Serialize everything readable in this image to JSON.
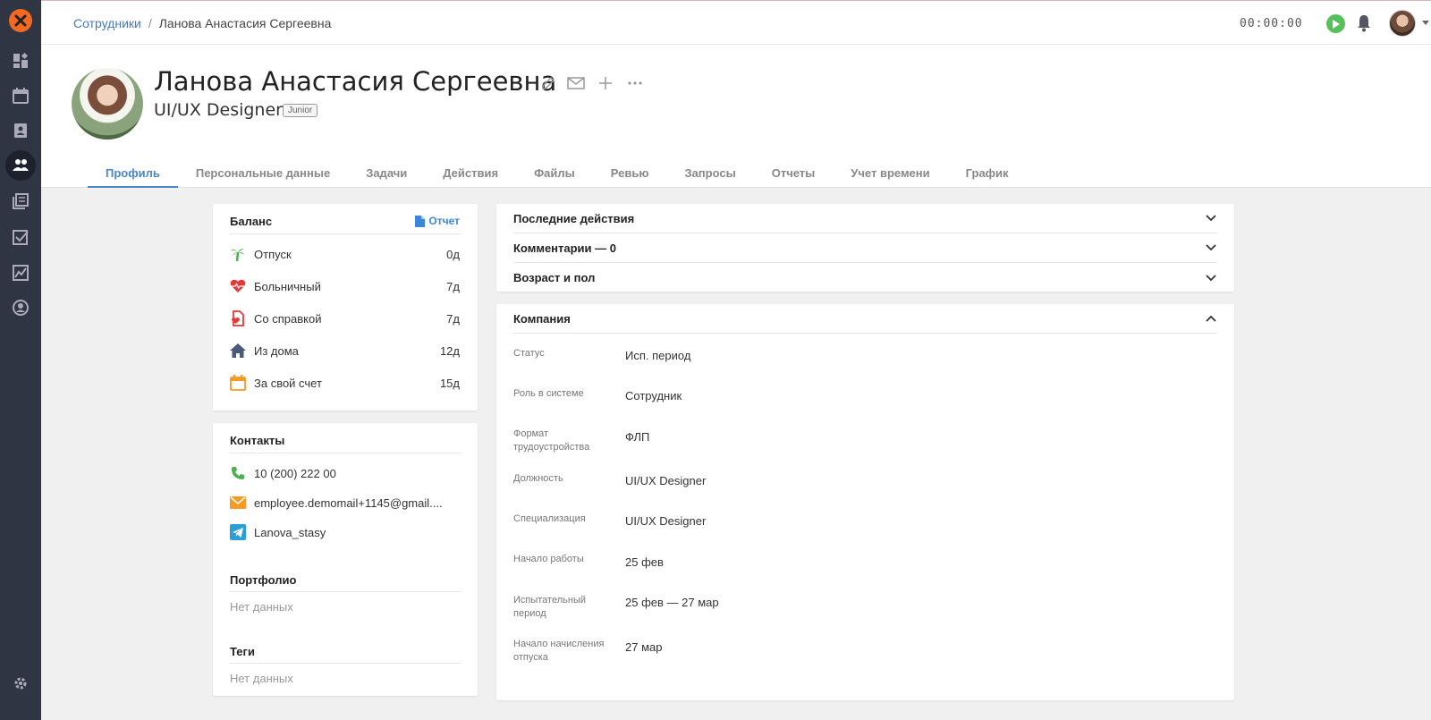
{
  "breadcrumb": {
    "parent": "Сотрудники",
    "separator": "/",
    "current": "Ланова Анастасия Сергеевна"
  },
  "timer": {
    "value": "00:00:00"
  },
  "profile": {
    "name": "Ланова Анастасия Сергеевна",
    "role": "UI/UX Designer",
    "level": "Junior"
  },
  "tabs": [
    {
      "label": "Профиль",
      "active": true
    },
    {
      "label": "Персональные данные"
    },
    {
      "label": "Задачи"
    },
    {
      "label": "Действия"
    },
    {
      "label": "Файлы"
    },
    {
      "label": "Ревью"
    },
    {
      "label": "Запросы"
    },
    {
      "label": "Отчеты"
    },
    {
      "label": "Учет времени"
    },
    {
      "label": "График"
    }
  ],
  "balance": {
    "title": "Баланс",
    "report_label": "Отчет",
    "items": [
      {
        "label": "Отпуск",
        "value": "0д",
        "icon": "palm-tree-icon",
        "color": "#4caf50"
      },
      {
        "label": "Больничный",
        "value": "7д",
        "icon": "heart-pulse-icon",
        "color": "#e53935"
      },
      {
        "label": "Со справкой",
        "value": "7д",
        "icon": "medical-note-icon",
        "color": "#e53935"
      },
      {
        "label": "Из дома",
        "value": "12д",
        "icon": "home-icon",
        "color": "#4a5a78"
      },
      {
        "label": "За свой счет",
        "value": "15д",
        "icon": "calendar-icon",
        "color": "#f59b23"
      }
    ]
  },
  "contacts": {
    "title": "Контакты",
    "phone": "10 (200) 222 00",
    "email": "employee.demomail+1145@gmail....",
    "telegram": "Lanova_stasy",
    "portfolio_title": "Портфолио",
    "portfolio_value": "Нет данных",
    "tags_title": "Теги",
    "tags_value": "Нет данных"
  },
  "accordion": [
    {
      "label": "Последние действия"
    },
    {
      "label": "Комментарии — 0"
    },
    {
      "label": "Возраст и пол"
    }
  ],
  "company": {
    "title": "Компания",
    "fields": [
      {
        "label": "Статус",
        "value": "Исп. период"
      },
      {
        "label": "Роль в системе",
        "value": "Сотрудник"
      },
      {
        "label": "Формат трудоустройства",
        "value": "ФЛП"
      },
      {
        "label": "Должность",
        "value": "UI/UX Designer"
      },
      {
        "label": "Специализация",
        "value": "UI/UX Designer"
      },
      {
        "label": "Начало работы",
        "value": "25 фев"
      },
      {
        "label": "Испытательный период",
        "value": "25 фев — 27 мар"
      },
      {
        "label": "Начало начисления отпуска",
        "value": "27 мар"
      }
    ]
  },
  "colors": {
    "accent": "#4a86c8",
    "sidebar": "#2f3542",
    "logo": "#f26a21",
    "play": "#56c15b"
  }
}
